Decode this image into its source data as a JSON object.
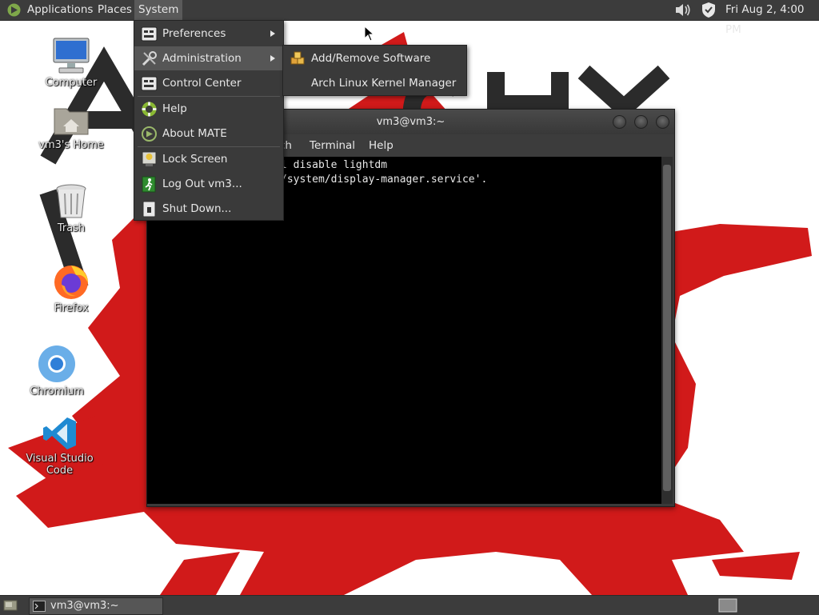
{
  "top_panel": {
    "applications": "Applications",
    "places": "Places",
    "system": "System",
    "clock": "Fri Aug  2,  4:00 PM",
    "icons": [
      "mate-logo-icon",
      "volume-icon",
      "shield-icon"
    ]
  },
  "desktop": {
    "icons": [
      {
        "label": "Computer",
        "icon": "computer-icon"
      },
      {
        "label": "vm3's Home",
        "icon": "home-folder-icon"
      },
      {
        "label": "Trash",
        "icon": "trash-icon"
      },
      {
        "label": "Firefox",
        "icon": "firefox-icon"
      },
      {
        "label": "Chromium",
        "icon": "chromium-icon"
      },
      {
        "label": "Visual Studio Code",
        "icon": "vscode-icon"
      }
    ]
  },
  "system_menu": {
    "items": [
      {
        "label": "Preferences",
        "icon": "preferences-icon",
        "submenu": true
      },
      {
        "label": "Administration",
        "icon": "tools-icon",
        "submenu": true,
        "highlighted": true
      },
      {
        "label": "Control Center",
        "icon": "control-center-icon"
      },
      {
        "label": "Help",
        "icon": "help-icon"
      },
      {
        "label": "About MATE",
        "icon": "mate-about-icon"
      },
      {
        "label": "Lock Screen",
        "icon": "lock-screen-icon"
      },
      {
        "label": "Log Out vm3...",
        "icon": "logout-icon"
      },
      {
        "label": "Shut Down...",
        "icon": "shutdown-icon"
      }
    ]
  },
  "admin_submenu": {
    "items": [
      {
        "label": "Add/Remove Software",
        "icon": "software-package-icon"
      },
      {
        "label": "Arch Linux Kernel Manager",
        "icon": ""
      }
    ]
  },
  "terminal": {
    "title": "vm3@vm3:~",
    "menu": [
      "ch",
      "Terminal",
      "Help"
    ],
    "lines": [
      "l disable lightdm",
      "/system/display-manager.service'."
    ]
  },
  "bottom_panel": {
    "task_label": "vm3@vm3:~"
  },
  "colors": {
    "panel": "#3c3c3c",
    "menu_bg": "#3a3a3a",
    "menu_highlight": "#565656",
    "wallpaper_red": "#d11a1a",
    "wallpaper_text": "#2b2b2b"
  }
}
